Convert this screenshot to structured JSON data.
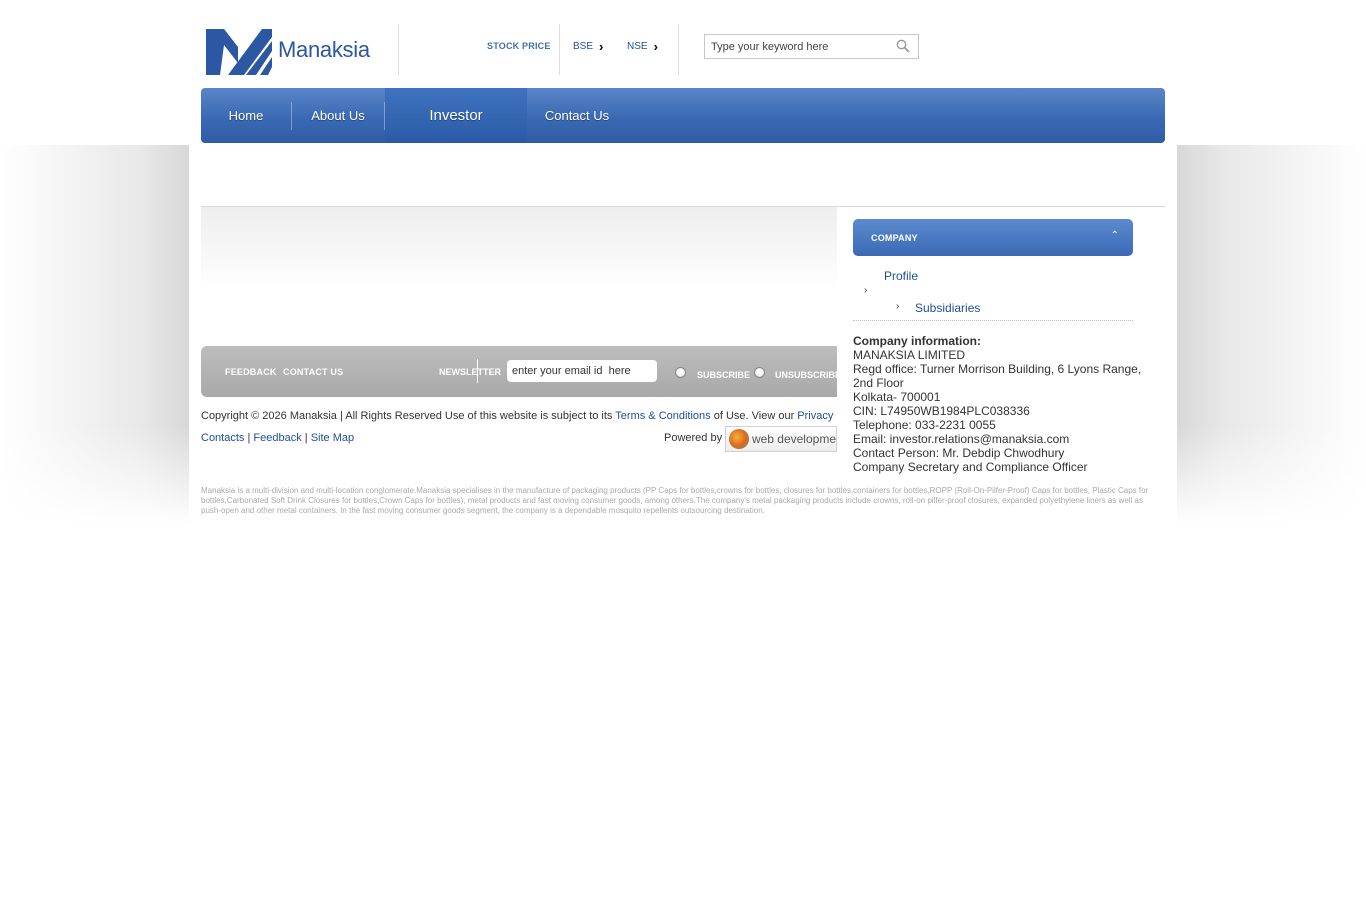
{
  "brand": {
    "name": "Manaksia",
    "color": "#2b57a3"
  },
  "header": {
    "stock_price_label": "STOCK PRICE",
    "exchanges": [
      "BSE",
      "NSE"
    ],
    "search_placeholder": "Type your keyword here"
  },
  "nav": {
    "items": [
      "Home",
      "About Us",
      "Investor",
      "Contact Us"
    ],
    "active": "Investor"
  },
  "footer_bar": {
    "feedback": "FEEDBACK",
    "contact_us": "CONTACT US",
    "newsletter": "NEWSLETTER",
    "email_value": "enter your email id  here",
    "subscribe": "SUBSCRIBE",
    "unsubscribe": "UNSUBSCRIBE"
  },
  "copyright": {
    "prefix": "Copyright © 2026 Manaksia | All Rights Reserved Use of this website is subject to its ",
    "terms": "Terms & Conditions",
    "middle": " of Use. View our ",
    "privacy": "Privacy"
  },
  "footer_links": {
    "contacts": "Contacts",
    "feedback": "Feedback",
    "sitemap": "Site Map",
    "separator": " | ",
    "powered_by": "Powered by",
    "powered_logo_text": "web developme"
  },
  "disclaimer": "Manaksia is a multi-division and multi-location conglomerate.Manaksia specialises in the manufacture of packaging products (PP Caps for bottles,crowns for bottles, closures for bottles,containers for bottles,ROPP (Roll-On-Pilfer-Proof) Caps for bottles, Plastic Caps for bottles,Carbonated Soft Drink Closures for bottles,Crown Caps for bottles), metal products and fast moving consumer goods, among others.The company's metal packaging products include crowns, roll-on pilfer-proof closures, expanded polyethylene liners as well as push-open and other metal containers. In the fast moving consumer goods segment, the company is a dependable mosquito repellents outsourcing destination.",
  "sidebar": {
    "heading": "COMPANY",
    "links": [
      "Profile",
      "Subsidiaries"
    ],
    "info_title": "Company information:",
    "info_lines": [
      "MANAKSIA LIMITED",
      "Regd office: Turner Morrison Building, 6 Lyons Range, 2nd Floor",
      "Kolkata- 700001",
      "CIN: L74950WB1984PLC038336",
      "Telephone: 033-2231 0055",
      "Email: investor.relations@manaksia.com",
      "Contact Person: Mr. Debdip Chwodhury",
      "Company Secretary and Compliance Officer"
    ]
  }
}
